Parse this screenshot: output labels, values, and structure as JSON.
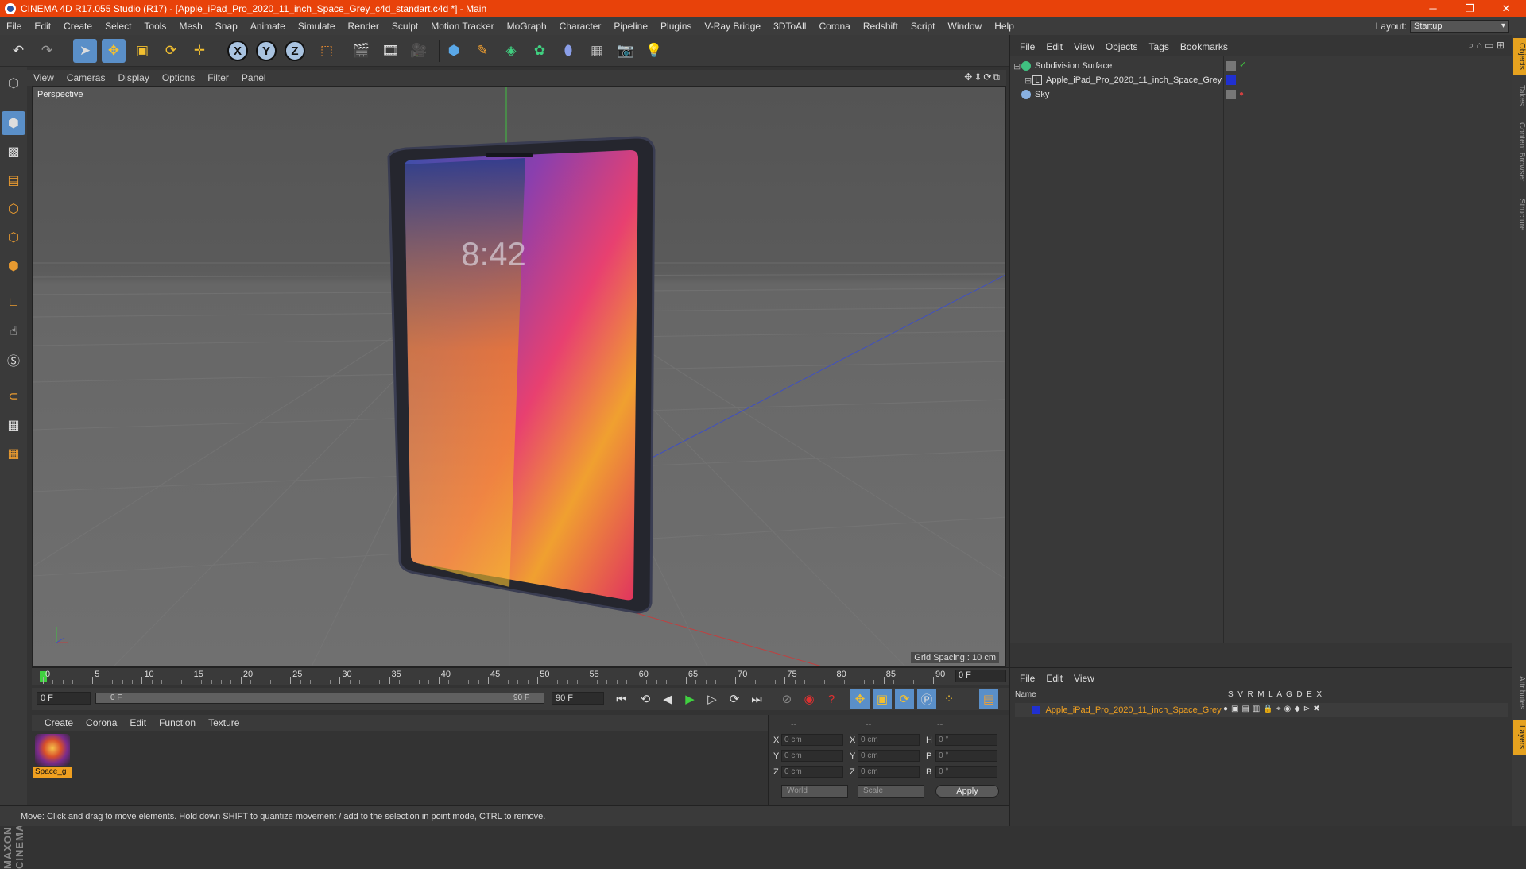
{
  "window": {
    "title": "CINEMA 4D R17.055 Studio (R17) - [Apple_iPad_Pro_2020_11_inch_Space_Grey_c4d_standart.c4d *] - Main"
  },
  "menubar": {
    "items": [
      "File",
      "Edit",
      "Create",
      "Select",
      "Tools",
      "Mesh",
      "Snap",
      "Animate",
      "Simulate",
      "Render",
      "Sculpt",
      "Motion Tracker",
      "MoGraph",
      "Character",
      "Pipeline",
      "Plugins",
      "V-Ray Bridge",
      "3DToAll",
      "Corona",
      "Redshift",
      "Script",
      "Window",
      "Help"
    ],
    "layout_label": "Layout:",
    "layout_value": "Startup"
  },
  "viewport": {
    "menu": [
      "View",
      "Cameras",
      "Display",
      "Options",
      "Filter",
      "Panel"
    ],
    "label": "Perspective",
    "grid_spacing": "Grid Spacing : 10 cm",
    "screen_time": "8:42"
  },
  "objects_panel": {
    "menu": [
      "File",
      "Edit",
      "View",
      "Objects",
      "Tags",
      "Bookmarks"
    ],
    "rows": [
      {
        "name": "Subdivision Surface"
      },
      {
        "name": "Apple_iPad_Pro_2020_11_inch_Space_Grey"
      },
      {
        "name": "Sky"
      }
    ]
  },
  "right_tabs": [
    "Objects",
    "Takes",
    "Content Browser",
    "Structure"
  ],
  "right_tabs_bottom": [
    "Attributes",
    "Layers"
  ],
  "layers_panel": {
    "menu": [
      "File",
      "Edit",
      "View"
    ],
    "header_name": "Name",
    "header_cols": "S  V  R  M  L  A  G  D  E  X",
    "row_name": "Apple_iPad_Pro_2020_11_inch_Space_Grey"
  },
  "timeline": {
    "ticks": [
      "0",
      "5",
      "10",
      "15",
      "20",
      "25",
      "30",
      "35",
      "40",
      "45",
      "50",
      "55",
      "60",
      "65",
      "70",
      "75",
      "80",
      "85",
      "90"
    ],
    "frame_end": "0 F"
  },
  "transport": {
    "current_frame": "0 F",
    "range_start": "0 F",
    "range_end": "90 F",
    "max_frame": "90 F"
  },
  "material_manager": {
    "menu": [
      "Create",
      "Corona",
      "Edit",
      "Function",
      "Texture"
    ],
    "material_name": "Space_g"
  },
  "coordinates": {
    "headers": [
      "--",
      "--",
      "--"
    ],
    "rows": [
      {
        "a": "X",
        "av": "0 cm",
        "b": "X",
        "bv": "0 cm",
        "c": "H",
        "cv": "0 °"
      },
      {
        "a": "Y",
        "av": "0 cm",
        "b": "Y",
        "bv": "0 cm",
        "c": "P",
        "cv": "0 °"
      },
      {
        "a": "Z",
        "av": "0 cm",
        "b": "Z",
        "bv": "0 cm",
        "c": "B",
        "cv": "0 °"
      }
    ],
    "space": "World",
    "mode": "Scale",
    "apply": "Apply"
  },
  "brand": "MAXON CINEMA 4D",
  "status": "Move: Click and drag to move elements. Hold down SHIFT to quantize movement / add to the selection in point mode, CTRL to remove."
}
